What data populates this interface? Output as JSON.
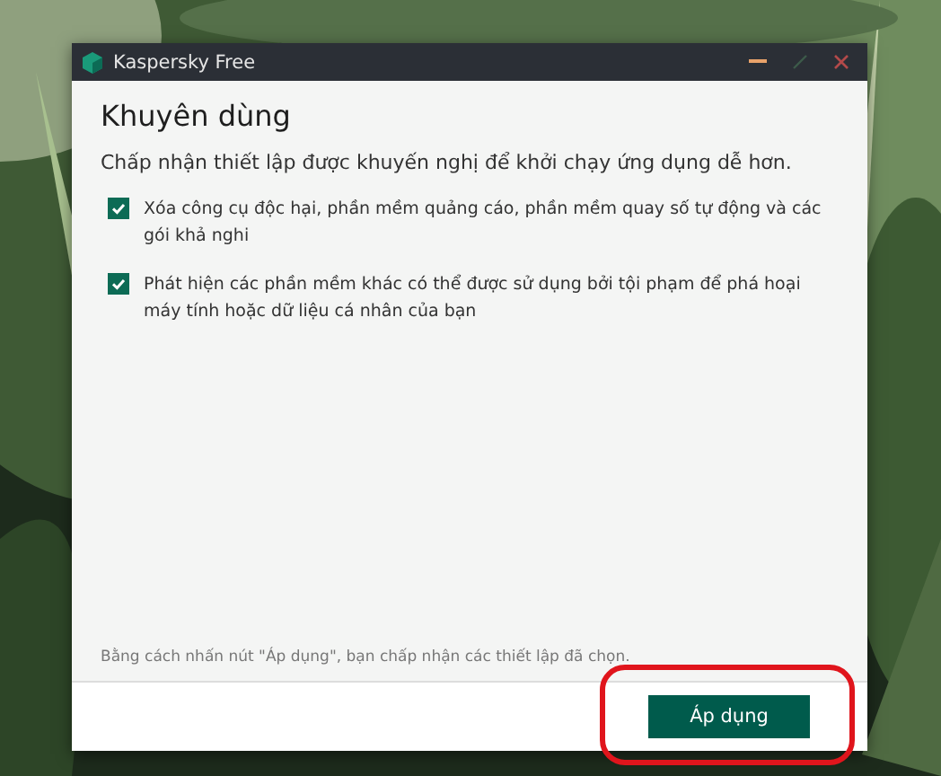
{
  "window": {
    "title": "Kaspersky Free"
  },
  "heading": "Khuyên dùng",
  "intro": "Chấp nhận thiết lập được khuyến nghị để khởi chạy ứng dụng dễ hơn.",
  "options": [
    {
      "label": "Xóa công cụ độc hại, phần mềm quảng cáo, phần mềm quay số tự động và các gói khả nghi",
      "checked": true
    },
    {
      "label": "Phát hiện các phần mềm khác có thể được sử dụng bởi tội phạm để phá hoại máy tính hoặc dữ liệu cá nhân của bạn",
      "checked": true
    }
  ],
  "note": "Bằng cách nhấn nút \"Áp dụng\", bạn chấp nhận các thiết lập đã chọn.",
  "apply_button": {
    "label": "Áp dụng",
    "highlighted": true
  }
}
